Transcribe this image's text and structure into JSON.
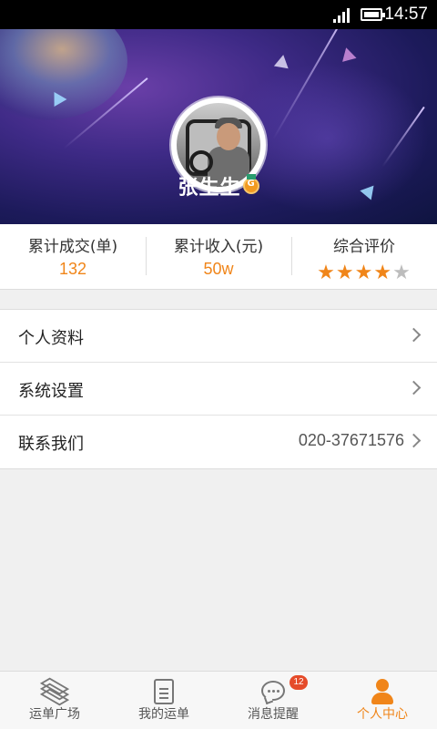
{
  "status_bar": {
    "time": "14:57"
  },
  "profile": {
    "name": "张生生"
  },
  "stats": [
    {
      "label": "累计成交(单)",
      "value": "132"
    },
    {
      "label": "累计收入(元)",
      "value": "50w"
    },
    {
      "label": "综合评价",
      "rating": 4,
      "max": 5
    }
  ],
  "menu": [
    {
      "title": "个人资料",
      "value": ""
    },
    {
      "title": "系统设置",
      "value": ""
    },
    {
      "title": "联系我们",
      "value": "020-37671576"
    }
  ],
  "tabs": [
    {
      "label": "运单广场",
      "icon": "layers-icon",
      "active": false
    },
    {
      "label": "我的运单",
      "icon": "document-icon",
      "active": false
    },
    {
      "label": "消息提醒",
      "icon": "chat-icon",
      "active": false,
      "badge": "12"
    },
    {
      "label": "个人中心",
      "icon": "person-icon",
      "active": true
    }
  ],
  "colors": {
    "accent": "#f08519",
    "badge": "#e54b2a"
  }
}
